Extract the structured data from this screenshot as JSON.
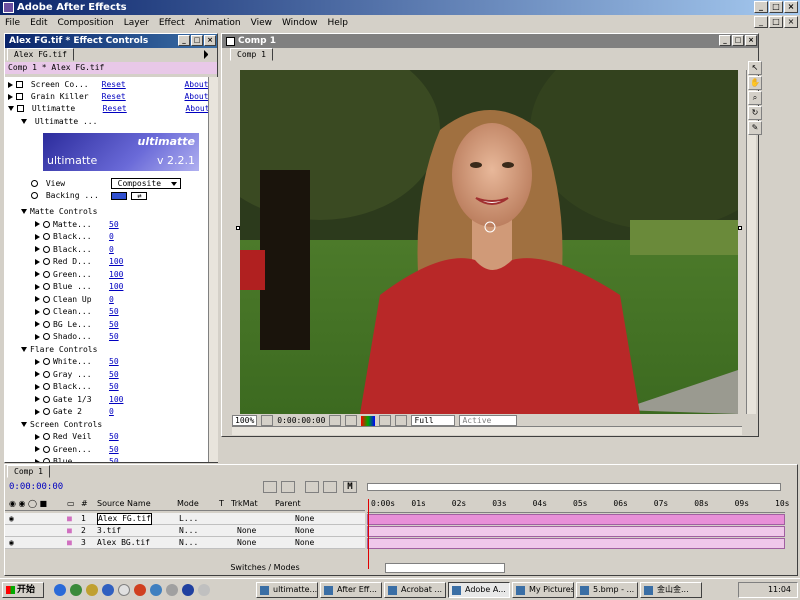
{
  "app": {
    "title": "Adobe After Effects"
  },
  "menu": [
    "File",
    "Edit",
    "Composition",
    "Layer",
    "Effect",
    "Animation",
    "View",
    "Window",
    "Help"
  ],
  "effect_controls": {
    "title": "Alex FG.tif * Effect Controls",
    "tab": "Alex FG.tif",
    "subtitle": "Comp 1 * Alex FG.tif",
    "effects": [
      {
        "name": "Screen Co...",
        "reset": "Reset",
        "about": "About..."
      },
      {
        "name": "Grain Killer",
        "reset": "Reset",
        "about": "About..."
      },
      {
        "name": "Ultimatte",
        "reset": "Reset",
        "about": "About..."
      }
    ],
    "ultimatte_sub": "Ultimatte ...",
    "logo": {
      "brand": "ultimatte",
      "brand2": "ultimatte",
      "version": "v 2.2.1"
    },
    "view": {
      "label": "View",
      "value": "Composite"
    },
    "backing": {
      "label": "Backing ..."
    },
    "groups": [
      {
        "name": "Matte Controls",
        "params": [
          {
            "name": "Matte...",
            "value": "50"
          },
          {
            "name": "Black...",
            "value": "0"
          },
          {
            "name": "Black...",
            "value": "0"
          },
          {
            "name": "Red D...",
            "value": "100"
          },
          {
            "name": "Green...",
            "value": "100"
          },
          {
            "name": "Blue ...",
            "value": "100"
          },
          {
            "name": "Clean Up",
            "value": "0"
          },
          {
            "name": "Clean...",
            "value": "50"
          },
          {
            "name": "BG Le...",
            "value": "50"
          },
          {
            "name": "Shado...",
            "value": "50"
          }
        ]
      },
      {
        "name": "Flare Controls",
        "params": [
          {
            "name": "White...",
            "value": "50"
          },
          {
            "name": "Gray ...",
            "value": "50"
          },
          {
            "name": "Black...",
            "value": "50"
          },
          {
            "name": "Gate 1/3",
            "value": "100"
          },
          {
            "name": "Gate 2",
            "value": "0"
          }
        ]
      },
      {
        "name": "Screen Controls",
        "params": [
          {
            "name": "Red Veil",
            "value": "50"
          },
          {
            "name": "Green...",
            "value": "50"
          },
          {
            "name": "Blue ...",
            "value": "50"
          }
        ]
      }
    ]
  },
  "comp": {
    "title": "Comp 1",
    "tab": "Comp 1",
    "zoom": "100%",
    "timecode": "0:00:00:00",
    "resolution": "Full",
    "camera": "Active C..."
  },
  "timeline": {
    "tab": "Comp 1",
    "timecode": "0:00:00:00",
    "columns": {
      "source": "Source Name",
      "mode": "Mode",
      "t": "T",
      "trkmat": "TrkMat",
      "parent": "Parent",
      "num": "#"
    },
    "layers": [
      {
        "num": "1",
        "name": "Alex FG.tif",
        "mode": "L...",
        "trkmat": "",
        "parent": "None"
      },
      {
        "num": "2",
        "name": "3.tif",
        "mode": "N...",
        "trkmat": "None",
        "parent": "None"
      },
      {
        "num": "3",
        "name": "Alex BG.tif",
        "mode": "N...",
        "trkmat": "None",
        "parent": "None"
      }
    ],
    "ruler": [
      "0:00s",
      "01s",
      "02s",
      "03s",
      "04s",
      "05s",
      "06s",
      "07s",
      "08s",
      "09s",
      "10s"
    ],
    "switches_label": "Switches / Modes"
  },
  "taskbar": {
    "start": "开始",
    "items": [
      "ultimatte...",
      "After Eff...",
      "Acrobat ...",
      "Adobe A...",
      "My Pictures",
      "5.bmp - ...",
      "金山金..."
    ],
    "clock": "11:04"
  }
}
